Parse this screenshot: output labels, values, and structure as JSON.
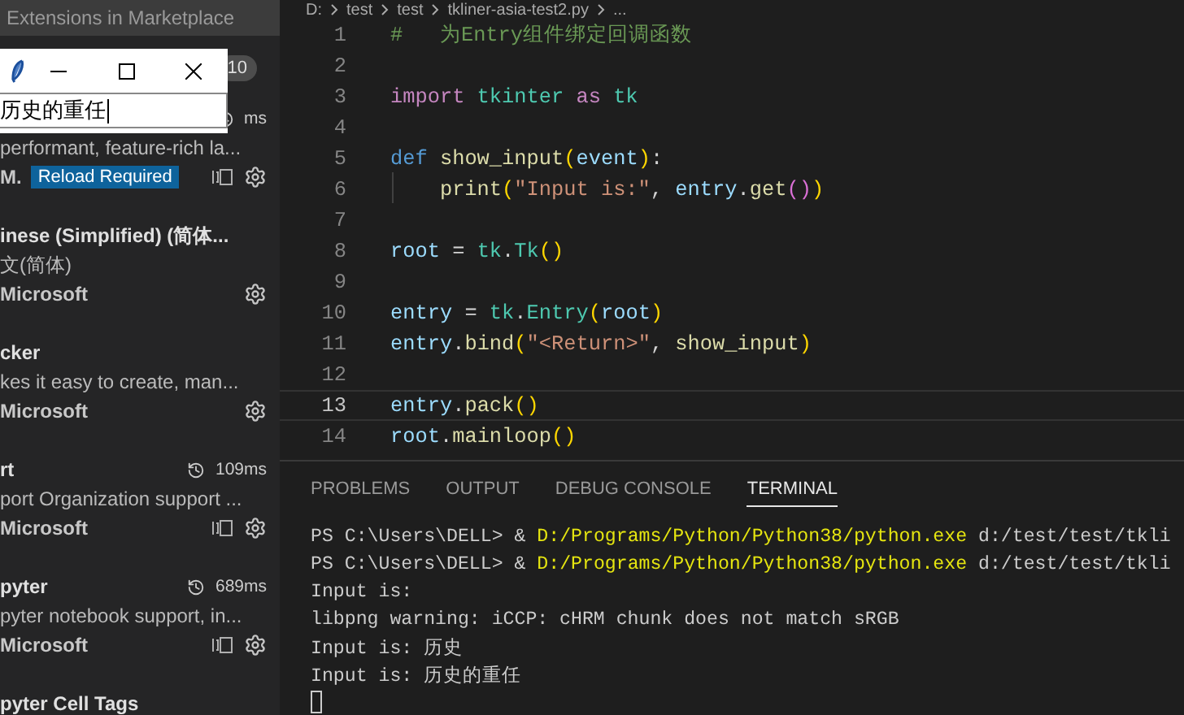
{
  "sidebar": {
    "search": {
      "placeholder": "Extensions in Marketplace"
    },
    "installed_count": "10",
    "items": [
      {
        "kind": "activated",
        "time": "ms",
        "description": "performant, feature-rich la...",
        "publisher": "M.",
        "badge": "Reload Required"
      },
      {
        "kind": "installed",
        "title": "inese (Simplified) (简体...",
        "description": "文(简体)",
        "publisher": "Microsoft"
      },
      {
        "kind": "installed",
        "title": "cker",
        "description": "kes it easy to create, man...",
        "publisher": "Microsoft"
      },
      {
        "kind": "activated",
        "title": "rt",
        "time": "109ms",
        "description": "port Organization support ...",
        "publisher": "Microsoft"
      },
      {
        "kind": "activated",
        "title": "pyter",
        "time": "689ms",
        "description": "pyter notebook support, in...",
        "publisher": "Microsoft"
      },
      {
        "title": "pyter Cell Tags"
      }
    ]
  },
  "tk_window": {
    "entry": {
      "value": "历史的重任"
    }
  },
  "breadcrumb": [
    "D:",
    "test",
    "test",
    "tkliner-asia-test2.py",
    "..."
  ],
  "editor": {
    "lines": [
      {
        "number": "1",
        "tokens": [
          {
            "kind": "comment",
            "text": "#   为Entry组件绑定回调函数"
          }
        ]
      },
      {
        "number": "2"
      },
      {
        "number": "3",
        "tokens": [
          {
            "kind": "keyword",
            "text": "import "
          },
          {
            "kind": "module",
            "text": "tkinter "
          },
          {
            "kind": "keyword",
            "text": "as "
          },
          {
            "kind": "module",
            "text": "tk"
          }
        ]
      },
      {
        "number": "4"
      },
      {
        "number": "5",
        "tokens": [
          {
            "kind": "storage",
            "text": "def "
          },
          {
            "kind": "function",
            "text": "show_input"
          },
          {
            "kind": "bracket",
            "text": "("
          },
          {
            "kind": "variable",
            "text": "event"
          },
          {
            "kind": "bracket",
            "text": ")"
          },
          {
            "kind": "plain",
            "text": ":"
          }
        ]
      },
      {
        "number": "6",
        "indent": true,
        "tokens": [
          {
            "kind": "function",
            "text": "print"
          },
          {
            "kind": "bracket",
            "text": "("
          },
          {
            "kind": "string",
            "text": "\"Input is:\""
          },
          {
            "kind": "plain",
            "text": ", "
          },
          {
            "kind": "variable",
            "text": "entry"
          },
          {
            "kind": "plain",
            "text": "."
          },
          {
            "kind": "function",
            "text": "get"
          },
          {
            "kind": "bracket2",
            "text": "()"
          },
          {
            "kind": "bracket",
            "text": ")"
          }
        ]
      },
      {
        "number": "7"
      },
      {
        "number": "8",
        "tokens": [
          {
            "kind": "variable",
            "text": "root"
          },
          {
            "kind": "plain",
            "text": " = "
          },
          {
            "kind": "module",
            "text": "tk"
          },
          {
            "kind": "plain",
            "text": "."
          },
          {
            "kind": "module",
            "text": "Tk"
          },
          {
            "kind": "bracket",
            "text": "()"
          }
        ]
      },
      {
        "number": "9"
      },
      {
        "number": "10",
        "tokens": [
          {
            "kind": "variable",
            "text": "entry"
          },
          {
            "kind": "plain",
            "text": " = "
          },
          {
            "kind": "module",
            "text": "tk"
          },
          {
            "kind": "plain",
            "text": "."
          },
          {
            "kind": "module",
            "text": "Entry"
          },
          {
            "kind": "bracket",
            "text": "("
          },
          {
            "kind": "variable",
            "text": "root"
          },
          {
            "kind": "bracket",
            "text": ")"
          }
        ]
      },
      {
        "number": "11",
        "tokens": [
          {
            "kind": "variable",
            "text": "entry"
          },
          {
            "kind": "plain",
            "text": "."
          },
          {
            "kind": "function",
            "text": "bind"
          },
          {
            "kind": "bracket",
            "text": "("
          },
          {
            "kind": "string",
            "text": "\"<Return>\""
          },
          {
            "kind": "plain",
            "text": ", "
          },
          {
            "kind": "function",
            "text": "show_input"
          },
          {
            "kind": "bracket",
            "text": ")"
          }
        ]
      },
      {
        "number": "12"
      },
      {
        "number": "13",
        "current": true,
        "tokens": [
          {
            "kind": "variable",
            "text": "entry"
          },
          {
            "kind": "plain",
            "text": "."
          },
          {
            "kind": "function",
            "text": "pack"
          },
          {
            "kind": "bracket",
            "text": "()"
          }
        ]
      },
      {
        "number": "14",
        "tokens": [
          {
            "kind": "variable",
            "text": "root"
          },
          {
            "kind": "plain",
            "text": "."
          },
          {
            "kind": "function",
            "text": "mainloop"
          },
          {
            "kind": "bracket",
            "text": "()"
          }
        ]
      }
    ]
  },
  "panel": {
    "tabs": [
      {
        "label": "PROBLEMS",
        "selected": false
      },
      {
        "label": "OUTPUT",
        "selected": false
      },
      {
        "label": "DEBUG CONSOLE",
        "selected": false
      },
      {
        "label": "TERMINAL",
        "selected": true
      }
    ],
    "terminal": [
      [
        {
          "kind": "plain",
          "text": "PS C:\\Users\\DELL> & "
        },
        {
          "kind": "path",
          "text": "D:/Programs/Python/Python38/python.exe"
        },
        {
          "kind": "plain",
          "text": " d:/test/test/tkli"
        }
      ],
      [
        {
          "kind": "plain",
          "text": "PS C:\\Users\\DELL> & "
        },
        {
          "kind": "path",
          "text": "D:/Programs/Python/Python38/python.exe"
        },
        {
          "kind": "plain",
          "text": " d:/test/test/tkli"
        }
      ],
      [
        {
          "kind": "plain",
          "text": "Input is:"
        }
      ],
      [
        {
          "kind": "plain",
          "text": "libpng warning: iCCP: cHRM chunk does not match sRGB"
        }
      ],
      [
        {
          "kind": "plain",
          "text": "Input is: 历史"
        }
      ],
      [
        {
          "kind": "plain",
          "text": "Input is: 历史的重任"
        }
      ]
    ]
  }
}
